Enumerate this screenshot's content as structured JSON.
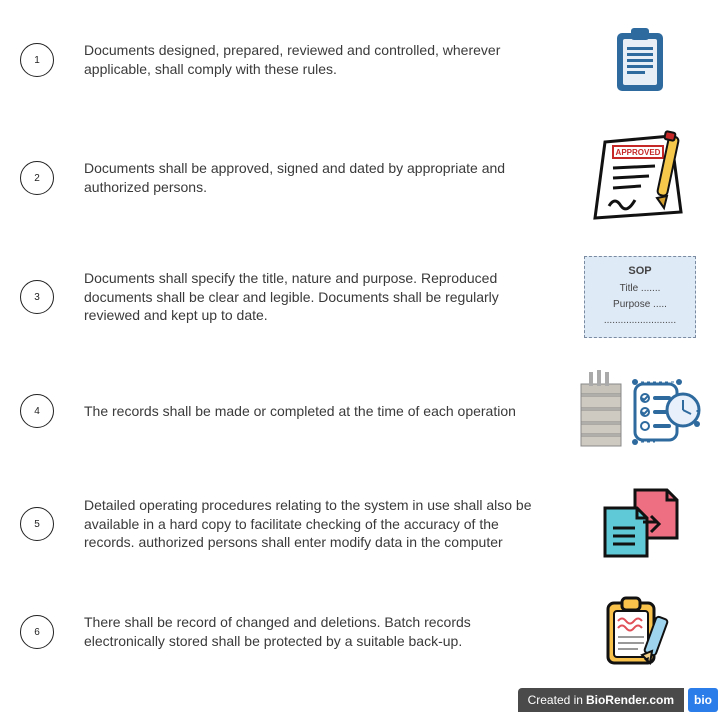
{
  "rules": [
    {
      "num": "1",
      "text": "Documents designed, prepared, reviewed and controlled, wherever applicable, shall comply with these rules."
    },
    {
      "num": "2",
      "text": "Documents shall be approved, signed and dated by appropriate and authorized persons."
    },
    {
      "num": "3",
      "text": "Documents shall specify the title, nature and purpose. Reproduced documents shall be clear and legible. Documents shall be regularly reviewed and kept up to date."
    },
    {
      "num": "4",
      "text": "The records shall be made or completed at the time of each operation"
    },
    {
      "num": "5",
      "text": "Detailed operating procedures relating to the system in use shall also be available in a hard copy to facilitate checking of the accuracy of the records. authorized persons shall enter modify data in the computer"
    },
    {
      "num": "6",
      "text": "There shall be record of changed and deletions. Batch records electronically stored shall be protected by a suitable back-up."
    }
  ],
  "sop": {
    "heading": "SOP",
    "line1": "Title .......",
    "line2": "Purpose .....",
    "line3": ".........................."
  },
  "approved_label": "APPROVED",
  "footer": {
    "prefix": "Created in ",
    "brand": "BioRender.com",
    "badge": "bio"
  }
}
